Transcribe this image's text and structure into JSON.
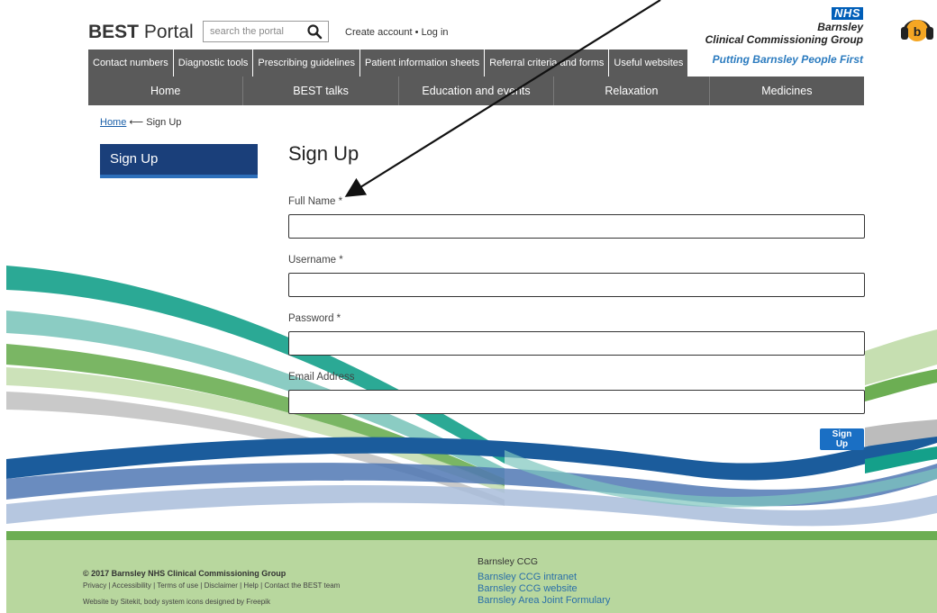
{
  "header": {
    "logo_bold": "BEST",
    "logo_rest": "Portal",
    "search_placeholder": "search the portal",
    "account_link": "Create account • Log in",
    "nhs_logo": "NHS",
    "nhs_org_line1": "Barnsley",
    "nhs_org_line2": "Clinical Commissioning Group",
    "tagline": "Putting Barnsley People First"
  },
  "top_tabs": [
    {
      "label": "Contact numbers"
    },
    {
      "label": "Diagnostic tools"
    },
    {
      "label": "Prescribing guidelines"
    },
    {
      "label": "Patient information sheets"
    },
    {
      "label": "Referral criteria and forms"
    },
    {
      "label": "Useful websites"
    }
  ],
  "main_nav": [
    {
      "label": "Home"
    },
    {
      "label": "BEST talks"
    },
    {
      "label": "Education and events"
    },
    {
      "label": "Relaxation"
    },
    {
      "label": "Medicines"
    }
  ],
  "breadcrumb": {
    "home": "Home",
    "separator": "⟵",
    "current": "Sign Up"
  },
  "sidebar": {
    "active_item": "Sign Up"
  },
  "form": {
    "title": "Sign Up",
    "full_name_label": "Full Name *",
    "username_label": "Username *",
    "password_label": "Password *",
    "email_label": "Email Address",
    "submit_label": "Sign Up"
  },
  "footer": {
    "copyright": "© 2017 Barnsley NHS Clinical Commissioning Group",
    "links": "Privacy | Accessibility | Terms of use | Disclaimer | Help | Contact the BEST team",
    "credit": "Website by Sitekit, body system icons designed by Freepik",
    "heading": "Barnsley CCG",
    "link1": "Barnsley CCG intranet",
    "link2": "Barnsley CCG website",
    "link3": "Barnsley Area Joint Formulary"
  },
  "colors": {
    "nav_grey": "#5a5a5a",
    "sidebar_navy": "#1a3f7a",
    "button_blue": "#1a6fc4",
    "footer_green": "#b8d79e",
    "footer_bar": "#6cae53",
    "nhs_blue": "#005eb8"
  }
}
